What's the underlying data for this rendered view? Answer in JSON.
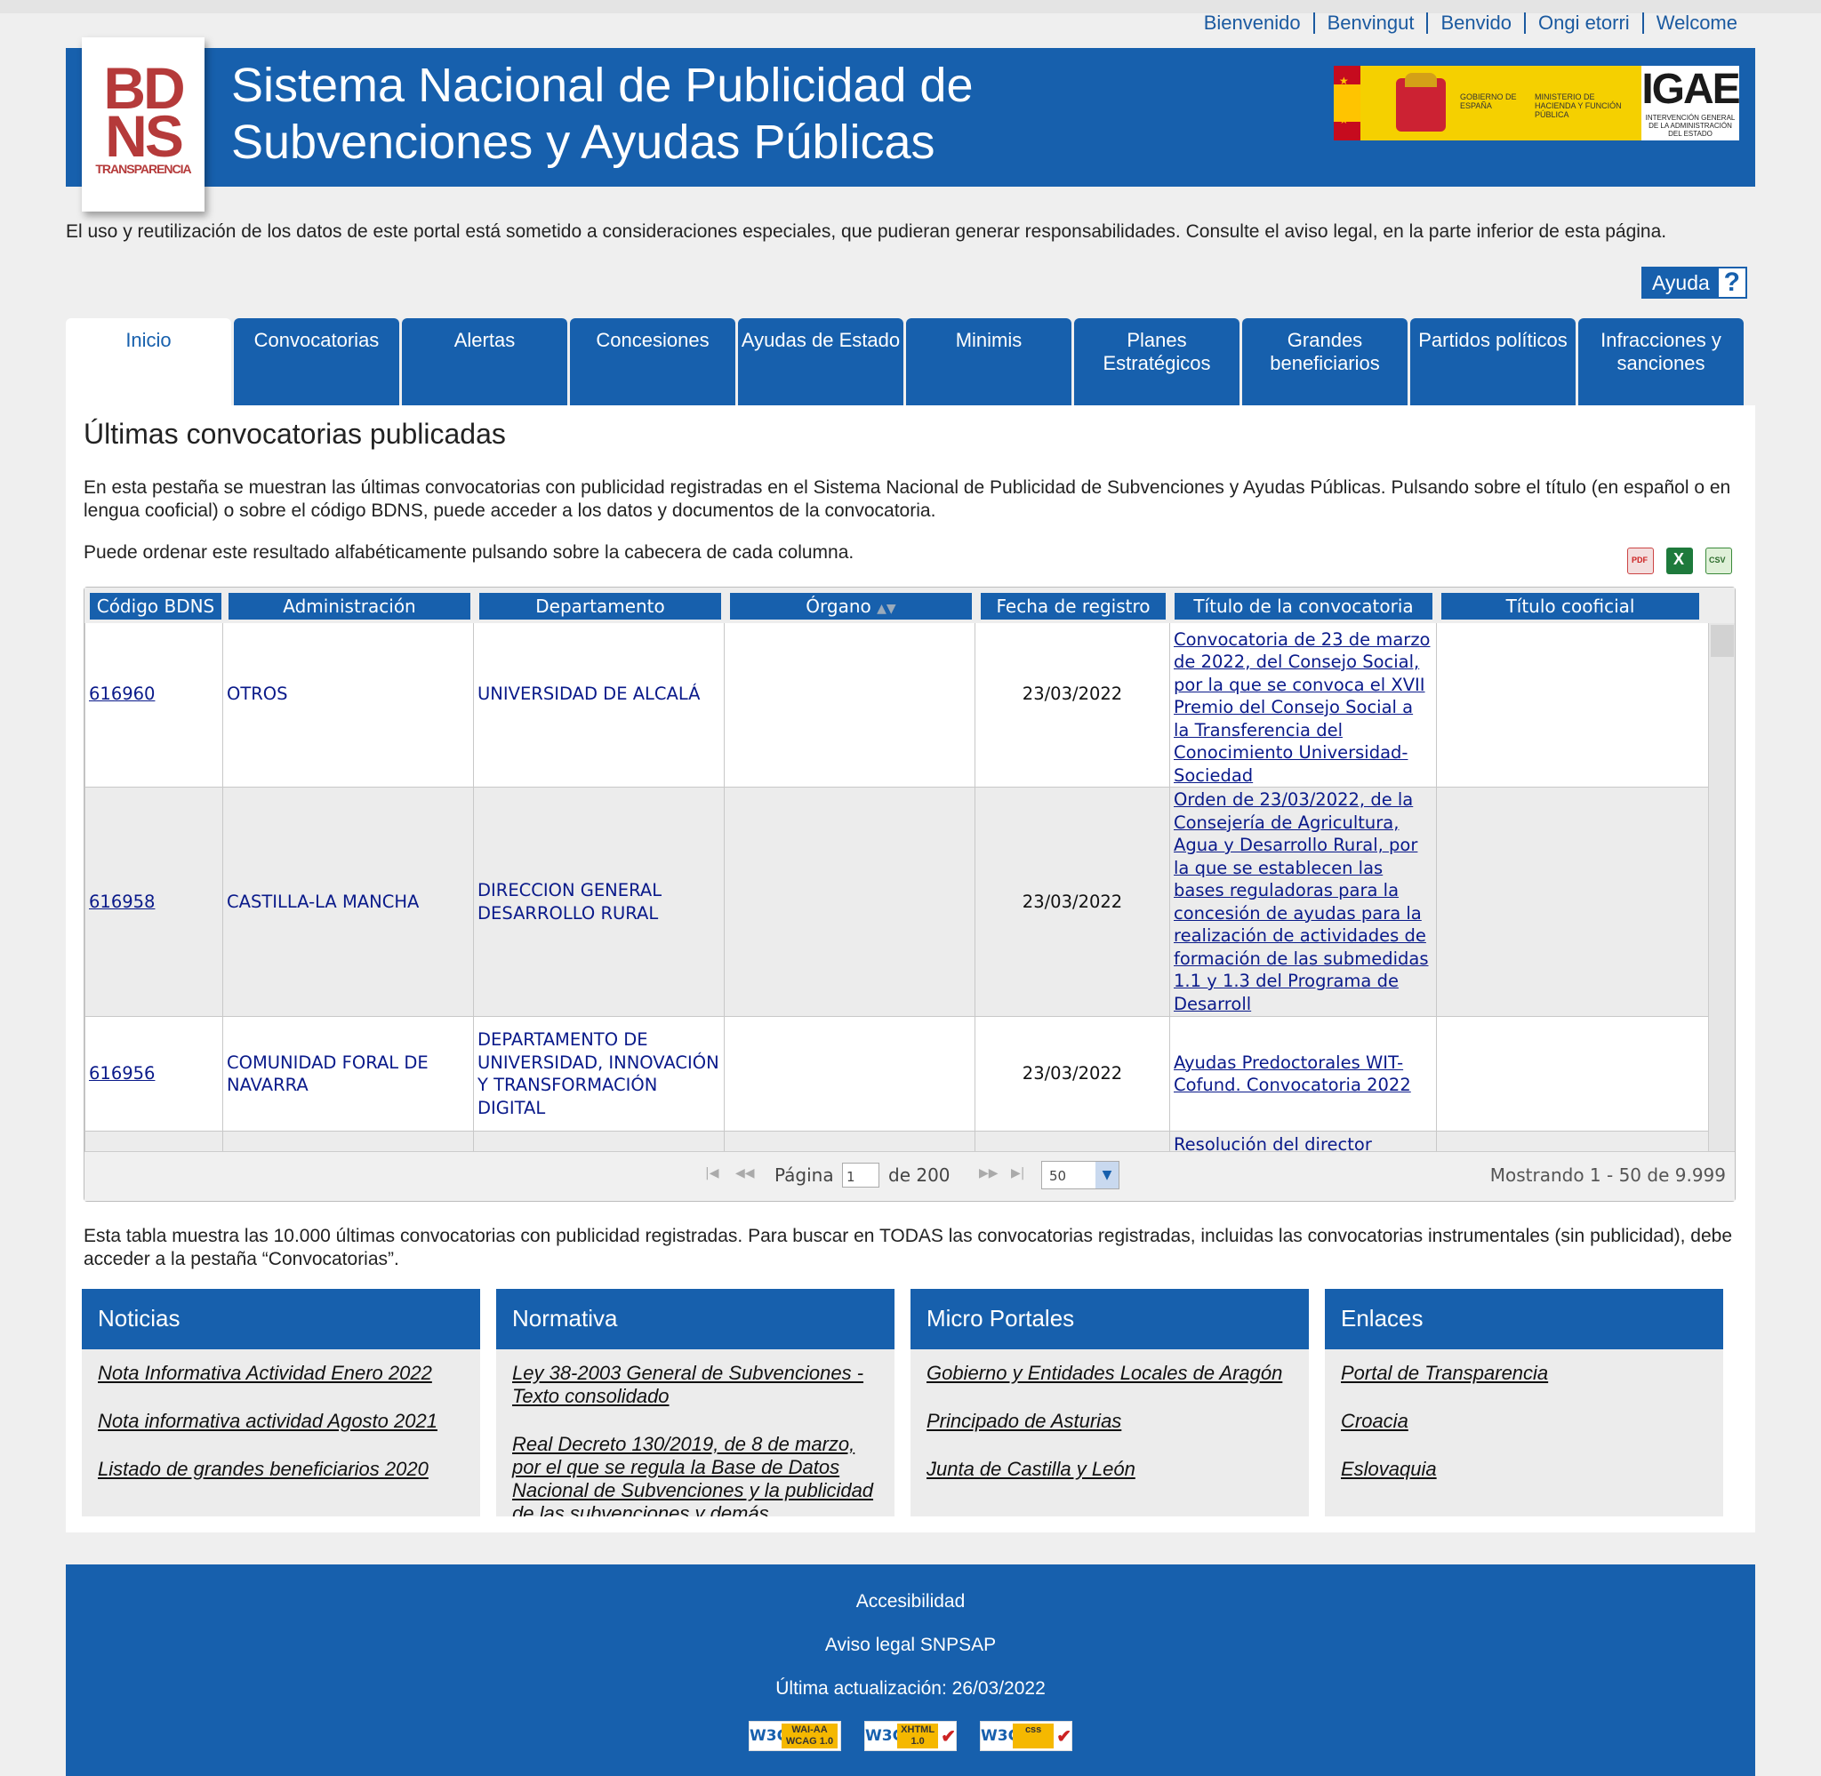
{
  "languages": [
    "Bienvenido",
    "Benvingut",
    "Benvido",
    "Ongi etorri",
    "Welcome"
  ],
  "header": {
    "logo_line1": "BD",
    "logo_line2": "NS",
    "logo_sub": "TRANSPARENCIA",
    "title_line1": "Sistema Nacional de Publicidad de",
    "title_line2": "Subvenciones y Ayudas Públicas",
    "gov_text1": "GOBIERNO DE ESPAÑA",
    "gov_text2": "MINISTERIO DE HACIENDA Y FUNCIÓN PÚBLICA",
    "igae_text": "IGAE",
    "igae_sub": "INTERVENCIÓN GENERAL DE LA ADMINISTRACIÓN DEL ESTADO"
  },
  "notice": "El uso y reutilización de los datos de este portal está sometido a consideraciones especiales, que pudieran generar responsabilidades. Consulte el aviso legal, en la parte inferior de esta página.",
  "help_label": "Ayuda",
  "help_icon": "?",
  "tabs": [
    {
      "label": "Inicio",
      "active": true
    },
    {
      "label": "Convocatorias"
    },
    {
      "label": "Alertas"
    },
    {
      "label": "Concesiones"
    },
    {
      "label": "Ayudas de Estado"
    },
    {
      "label": "Minimis"
    },
    {
      "label": "Planes Estratégicos"
    },
    {
      "label": "Grandes beneficiarios"
    },
    {
      "label": "Partidos políticos"
    },
    {
      "label": "Infracciones y sanciones"
    }
  ],
  "main": {
    "heading": "Últimas convocatorias publicadas",
    "intro": "En esta pestaña se muestran las últimas convocatorias con publicidad registradas en el Sistema Nacional de Publicidad de Subvenciones y Ayudas Públicas. Pulsando sobre el título (en español o en lengua cooficial) o sobre el código BDNS, puede acceder a los datos y documentos de la convocatoria.",
    "sort_note": "Puede ordenar este resultado alfabéticamente pulsando sobre la cabecera de cada columna.",
    "exports": [
      "pdf-icon",
      "excel-icon",
      "csv-icon"
    ]
  },
  "grid": {
    "columns": [
      "Código BDNS",
      "Administración",
      "Departamento",
      "Órgano",
      "Fecha de registro",
      "Título de la convocatoria",
      "Título cooficial"
    ],
    "sorted_column": "Órgano",
    "rows": [
      {
        "codigo": "616960",
        "admin": "OTROS",
        "depto": "UNIVERSIDAD DE ALCALÁ",
        "organo": "",
        "fecha": "23/03/2022",
        "titulo": "Convocatoria de 23 de marzo de 2022, del Consejo Social, por la que se convoca el XVII Premio del Consejo Social a la Transferencia del Conocimiento Universidad-Sociedad",
        "cooficial": ""
      },
      {
        "codigo": "616958",
        "admin": "CASTILLA-LA MANCHA",
        "depto": "DIRECCION GENERAL DESARROLLO RURAL",
        "organo": "",
        "fecha": "23/03/2022",
        "titulo": "Orden de 23/03/2022, de la Consejería de Agricultura, Agua y Desarrollo Rural, por la que se establecen las bases reguladoras para la concesión de ayudas para la realización de actividades de formación de las submedidas 1.1 y 1.3 del Programa de Desarroll",
        "cooficial": ""
      },
      {
        "codigo": "616956",
        "admin": "COMUNIDAD FORAL DE NAVARRA",
        "depto": "DEPARTAMENTO DE UNIVERSIDAD, INNOVACIÓN Y TRANSFORMACIÓN DIGITAL",
        "organo": "",
        "fecha": "23/03/2022",
        "titulo": "Ayudas Predoctorales WIT-Cofund. Convocatoria 2022",
        "cooficial": ""
      },
      {
        "codigo": "",
        "admin": "",
        "depto": "",
        "organo": "",
        "fecha": "",
        "titulo": "Resolución del director",
        "cooficial": ""
      }
    ],
    "pager": {
      "page_label": "Página",
      "page_value": "1",
      "of_label": "de 200",
      "rows_per_page": "50",
      "showing": "Mostrando 1 - 50 de 9.999"
    }
  },
  "table_note": "Esta tabla muestra las 10.000 últimas convocatorias con publicidad registradas. Para buscar en TODAS las convocatorias registradas, incluidas las convocatorias instrumentales (sin publicidad), debe acceder a la pestaña “Convocatorias”.",
  "boxes": [
    {
      "title": "Noticias",
      "items": [
        "Nota Informativa Actividad Enero 2022",
        "Nota informativa actividad Agosto 2021",
        "Listado de grandes beneficiarios 2020"
      ]
    },
    {
      "title": "Normativa",
      "items": [
        "Ley 38-2003 General de Subvenciones - Texto consolidado",
        "Real Decreto 130/2019, de 8 de marzo, por el que se regula la Base de Datos Nacional de Subvenciones y la publicidad de las subvenciones y demás"
      ]
    },
    {
      "title": "Micro Portales",
      "items": [
        "Gobierno y Entidades Locales de Aragón",
        "Principado de Asturias",
        "Junta de Castilla y León"
      ]
    },
    {
      "title": "Enlaces",
      "items": [
        "Portal de Transparencia",
        "Croacia",
        "Eslovaquia"
      ]
    }
  ],
  "footer": {
    "accesibilidad": "Accesibilidad",
    "aviso": "Aviso legal SNPSAP",
    "actualizacion": "Última actualización: 26/03/2022",
    "badges": [
      {
        "w3c": "W3C",
        "tag": "WAI-AA WCAG 1.0"
      },
      {
        "w3c": "W3C",
        "tag": "XHTML 1.0"
      },
      {
        "w3c": "W3C",
        "tag": "css"
      }
    ]
  },
  "colors": {
    "brand_blue": "#1760ad",
    "link_blue": "#1b5aa0",
    "logo_red": "#b53a3a"
  }
}
